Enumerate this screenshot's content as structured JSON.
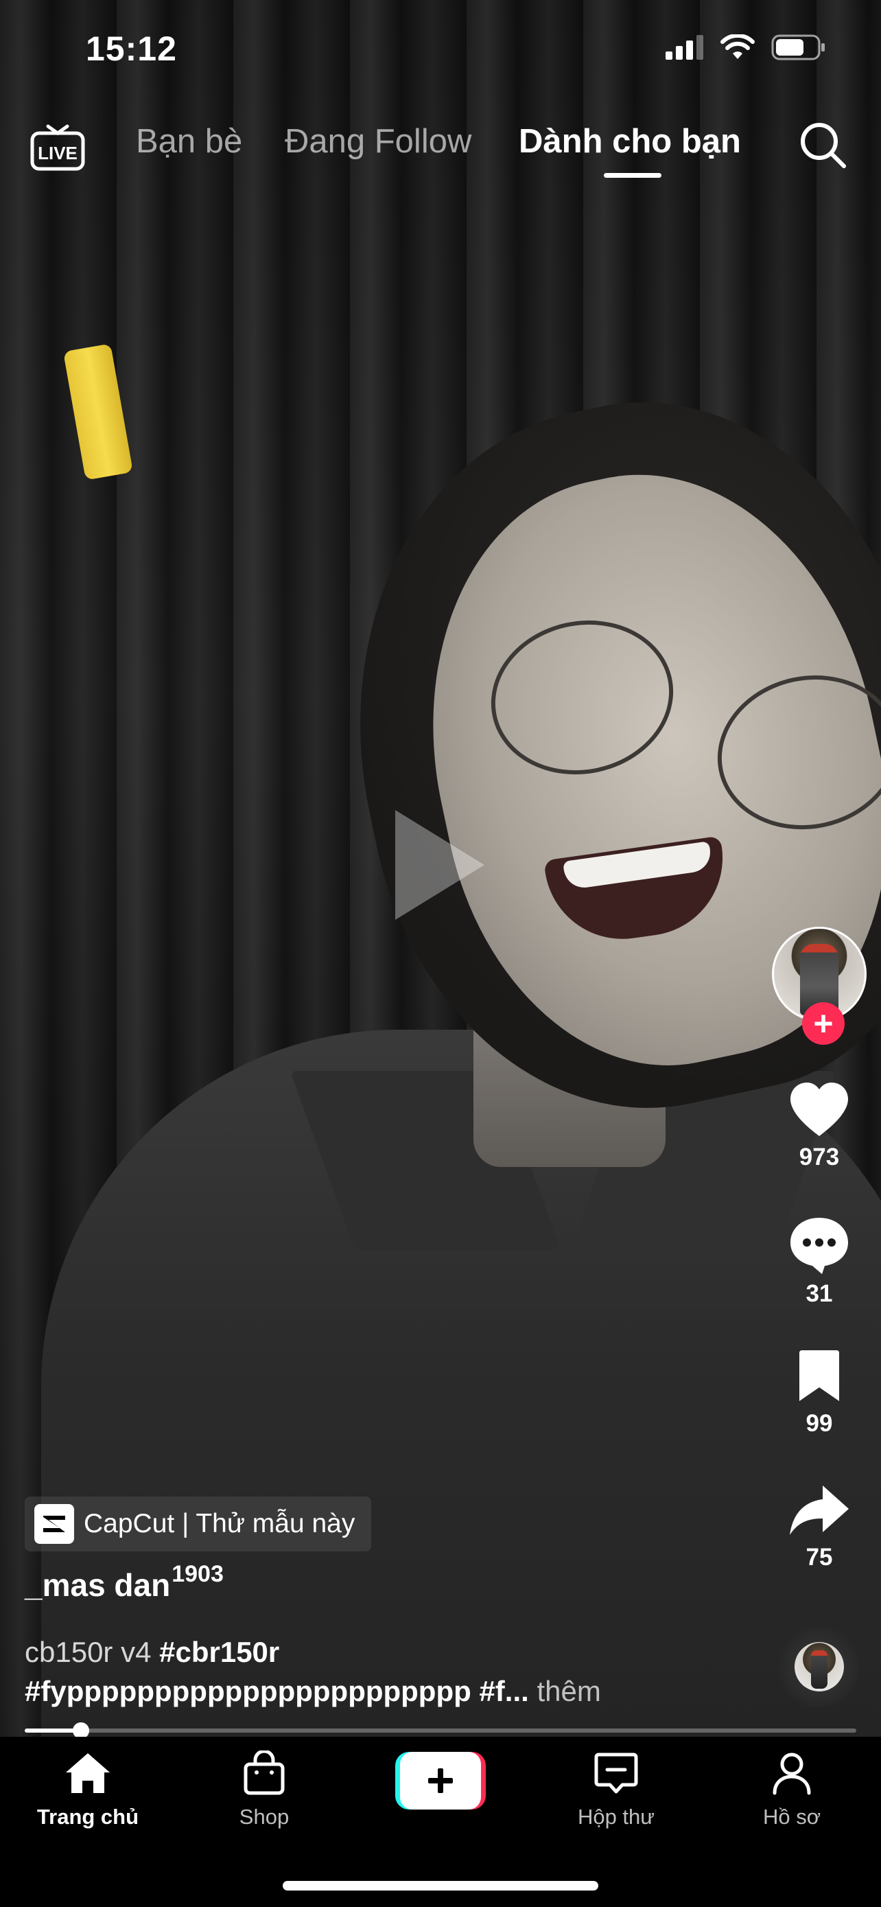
{
  "status_bar": {
    "time": "15:12"
  },
  "top_nav": {
    "live_label": "LIVE",
    "tabs": [
      {
        "label": "Bạn bè",
        "active": false
      },
      {
        "label": "Đang Follow",
        "active": false
      },
      {
        "label": "Dành cho bạn",
        "active": true
      }
    ]
  },
  "actions": {
    "likes": "973",
    "comments": "31",
    "saves": "99",
    "shares": "75"
  },
  "post": {
    "template_chip": "CapCut | Thử mẫu này",
    "username": "_mas dan",
    "username_superscript": "1903",
    "caption_line1_plain": "cb150r v4",
    "caption_line1_tag": "#cbr150r",
    "caption_line2_tag": "#fyppppppppppppppppppppppp",
    "caption_line2_tag2": "#f...",
    "caption_more": "thêm",
    "progress": 0.068
  },
  "tab_bar": {
    "items": [
      {
        "label": "Trang chủ",
        "active": true
      },
      {
        "label": "Shop",
        "active": false
      },
      {
        "label": "Hộp thư",
        "active": false
      },
      {
        "label": "Hồ sơ",
        "active": false
      }
    ]
  },
  "colors": {
    "accent_red": "#fe2c55",
    "accent_cyan": "#25f4ee"
  },
  "icons": [
    "live-icon",
    "search-icon",
    "heart-icon",
    "comment-icon",
    "bookmark-icon",
    "share-icon",
    "home-icon",
    "shop-bag-icon",
    "plus-icon",
    "inbox-icon",
    "profile-icon",
    "capcut-icon",
    "play-icon"
  ]
}
